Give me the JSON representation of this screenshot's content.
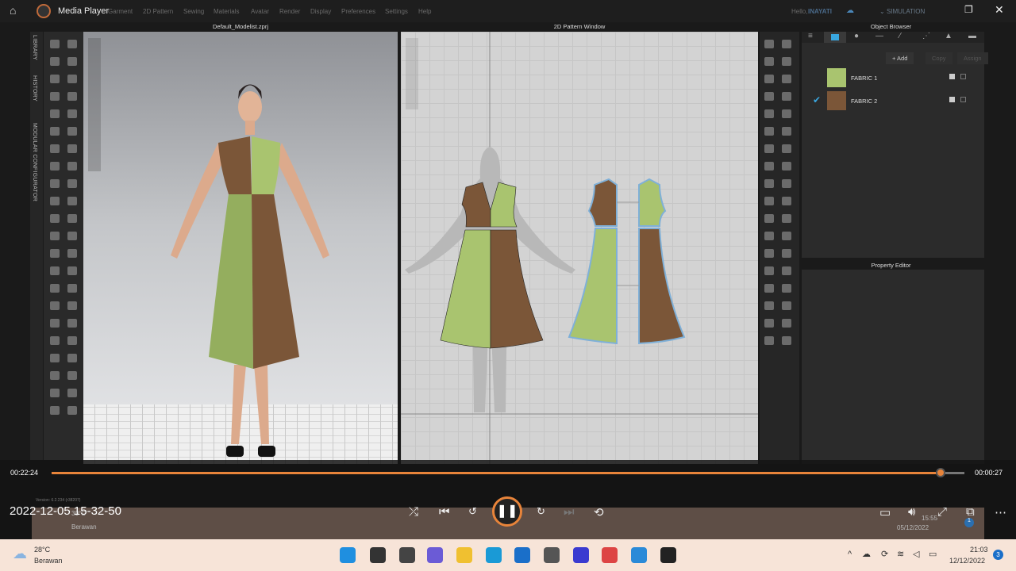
{
  "app": {
    "title": "Media Player",
    "menu": [
      "Garment",
      "2D Pattern",
      "Sewing",
      "Materials",
      "Avatar",
      "Render",
      "Display",
      "Preferences",
      "Settings",
      "Help"
    ],
    "greeting": "Hello,",
    "user": "INAYATI",
    "mode": "SIMULATION"
  },
  "left_tabs": [
    "LIBRARY",
    "HISTORY",
    "MODULAR CONFIGURATOR"
  ],
  "viewport3d": {
    "title": "Default_Modelist.zprj",
    "version": "Version: 6.2.234 (r38207)"
  },
  "viewport2d": {
    "title": "2D Pattern Window"
  },
  "object_browser": {
    "title": "Object Browser",
    "add": "+ Add",
    "copy": "Copy",
    "assign": "Assign",
    "fabrics": [
      {
        "name": "FABRIC 1",
        "color": "#a9c46f",
        "selected": false
      },
      {
        "name": "FABRIC 2",
        "color": "#7b5638",
        "selected": true
      }
    ]
  },
  "property_editor": {
    "title": "Property Editor"
  },
  "player": {
    "elapsed": "00:22:24",
    "remaining": "00:00:27",
    "progress": 0.974,
    "timestamp": "2022-12-05 15-32-50",
    "accent": "#e8843a"
  },
  "video_taskbar": {
    "temp": "30°C",
    "weather": "Berawan",
    "time": "15:55",
    "date": "05/12/2022",
    "badge": "1"
  },
  "taskbar": {
    "temp": "28°C",
    "weather": "Berawan",
    "time": "21:03",
    "date": "12/12/2022",
    "badge": "3"
  }
}
